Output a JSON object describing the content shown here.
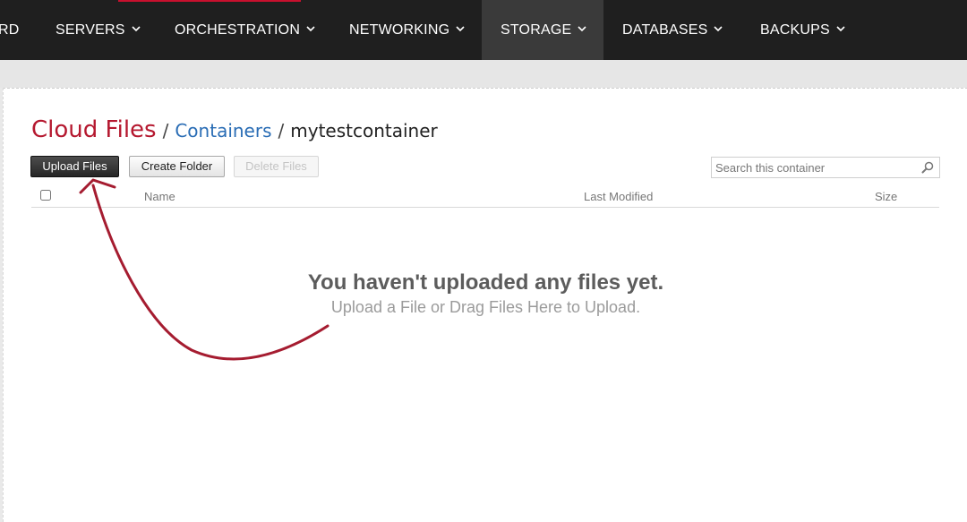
{
  "nav": {
    "items": [
      {
        "label": "RD",
        "active": false,
        "dropdown": false
      },
      {
        "label": "SERVERS",
        "active": false,
        "dropdown": true
      },
      {
        "label": "ORCHESTRATION",
        "active": false,
        "dropdown": true
      },
      {
        "label": "NETWORKING",
        "active": false,
        "dropdown": true
      },
      {
        "label": "STORAGE",
        "active": true,
        "dropdown": true
      },
      {
        "label": "DATABASES",
        "active": false,
        "dropdown": true
      },
      {
        "label": "BACKUPS",
        "active": false,
        "dropdown": true
      }
    ],
    "accent_color": "#c8102e"
  },
  "breadcrumb": {
    "root": "Cloud Files",
    "separator": "/",
    "link": "Containers",
    "current": "mytestcontainer"
  },
  "toolbar": {
    "upload_label": "Upload Files",
    "create_folder_label": "Create Folder",
    "delete_label": "Delete Files",
    "delete_disabled": true
  },
  "search": {
    "placeholder": "Search this container",
    "value": "",
    "icon": "search-icon"
  },
  "table": {
    "columns": [
      "Name",
      "Last Modified",
      "Size"
    ],
    "rows": []
  },
  "empty_state": {
    "title": "You haven't uploaded any files yet.",
    "subtitle": "Upload a File or Drag Files Here to Upload."
  },
  "annotation": {
    "arrow_color": "#a51c30",
    "points_to": "upload-files-button"
  },
  "colors": {
    "nav_bg": "#1f1f1f",
    "nav_active_bg": "#3a3a3a",
    "brand_red": "#b5182f",
    "link_blue": "#2a6db5"
  }
}
